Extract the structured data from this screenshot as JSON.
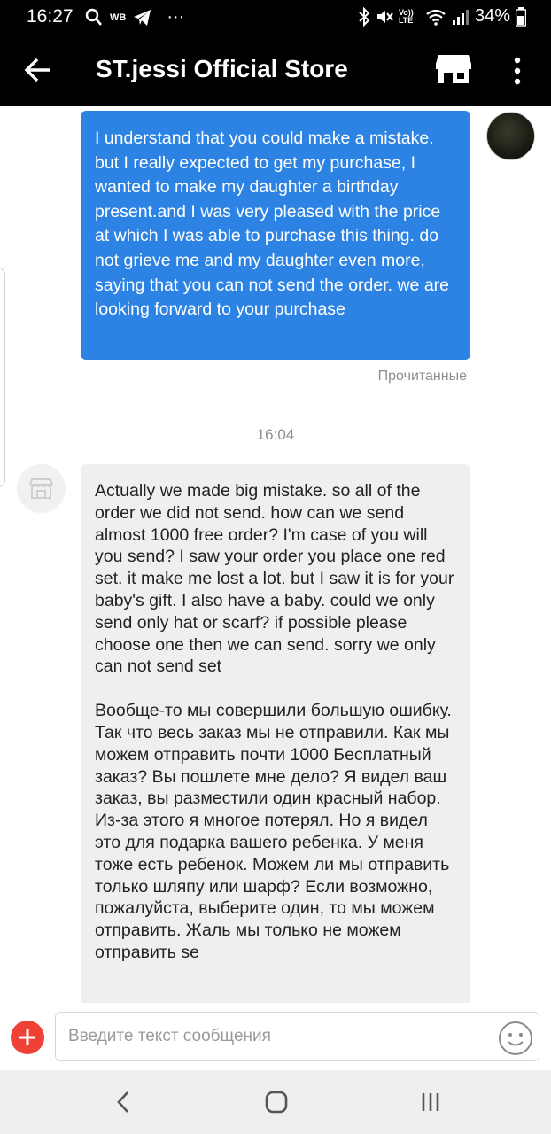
{
  "status_bar": {
    "time": "16:27",
    "wb": "WB",
    "dots": "···",
    "volte": "Vo)) LTE",
    "battery": "34%"
  },
  "header": {
    "title": "ST.jessi Official Store"
  },
  "chat": {
    "messages": [
      {
        "sender": "user",
        "text": "I understand that you could make a mistake.  but I really expected to get my purchase, I wanted to make my daughter a birthday present.and I was very pleased with the price at which I was able to purchase this thing.  do not grieve me and my daughter even more, saying that you can not send the order. we are looking forward to your purchase",
        "status": "Прочитанные"
      },
      {
        "sender": "store",
        "time": "16:04",
        "text_original": "Actually we made big mistake. so all of the order we did not send.  how can we send almost  1000 free order? I'm case of you will you send?  I saw your order you place one red set.  it make me lost a lot. but I saw it is for your baby's gift.  I also have a baby.  could we only send only hat or scarf?  if possible please choose one then we can send.  sorry we only can not send set",
        "text_translated": "Вообще-то мы совершили большую ошибку. Так что весь заказ мы не отправили. Как мы можем отправить почти 1000 Бесплатный заказ? Вы пошлете мне дело? Я видел ваш заказ, вы разместили один красный набор. Из-за этого я многое потерял. Но я видел это для подарка вашего ребенка. У меня тоже есть ребенок. Можем ли мы отправить только шляпу или шарф? Если возможно, пожалуйста, выберите один, то мы можем отправить. Жаль мы только не можем отправить se"
      }
    ]
  },
  "input": {
    "placeholder": "Введите текст сообщения"
  },
  "icons": {
    "back": "arrow-left-icon",
    "store": "store-icon",
    "more": "more-vertical-icon",
    "plus": "plus-icon",
    "emoji": "smiley-icon"
  },
  "colors": {
    "header_bg": "#000000",
    "outgoing_bubble": "#2d83e3",
    "incoming_bubble": "#efefef",
    "plus_button": "#ef4135"
  }
}
